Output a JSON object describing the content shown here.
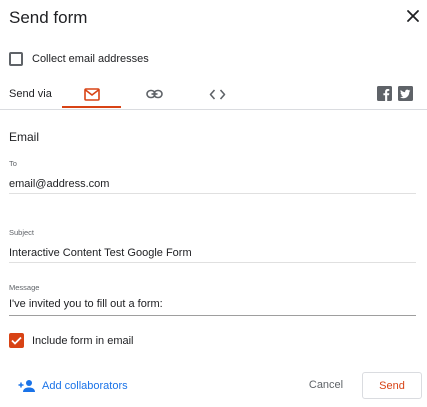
{
  "dialog": {
    "title": "Send form"
  },
  "collect": {
    "label": "Collect email addresses",
    "checked": false
  },
  "send_via": {
    "label": "Send via",
    "tabs": [
      {
        "icon": "mail-icon",
        "selected": true
      },
      {
        "icon": "link-icon",
        "selected": false
      },
      {
        "icon": "embed-code-icon",
        "selected": false
      }
    ],
    "share": [
      {
        "icon": "facebook-icon"
      },
      {
        "icon": "twitter-icon"
      }
    ]
  },
  "email": {
    "section_title": "Email",
    "to_label": "To",
    "to_value": "email@address.com",
    "subject_label": "Subject",
    "subject_value": "Interactive Content Test Google Form",
    "message_label": "Message",
    "message_value": "I've invited you to fill out a form:"
  },
  "include": {
    "label": "Include form in email",
    "checked": true
  },
  "footer": {
    "add_collaborators": "Add collaborators",
    "cancel": "Cancel",
    "send": "Send"
  },
  "colors": {
    "accent": "#d84315",
    "link": "#1a73e8",
    "icon": "#5f6368"
  }
}
